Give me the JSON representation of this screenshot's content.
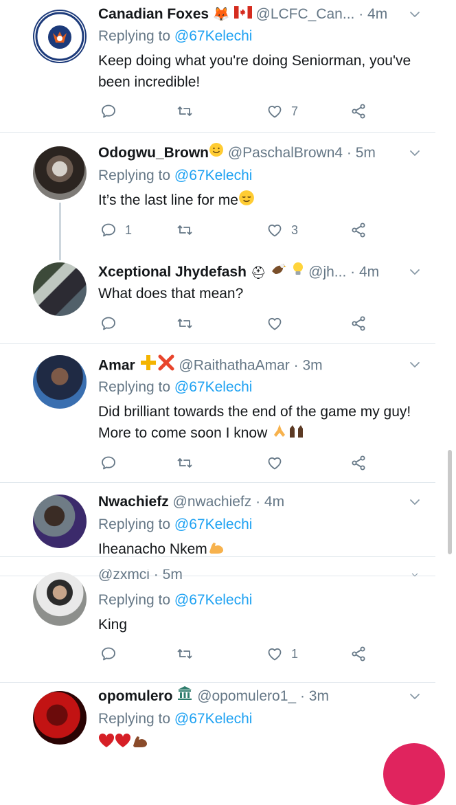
{
  "reply_prefix": "Replying to",
  "tweets": [
    {
      "name": "Canadian Foxes",
      "handle": "@LCFC_Can...",
      "time": "· 4m",
      "reply_to": "@67Kelechi",
      "text": "Keep doing what you're doing Seniorman, you've been incredible!",
      "likes": "7",
      "replies": "",
      "avatar_text": "CANADIAN FOXES"
    },
    {
      "name": "Odogwu_Brown",
      "handle": "@PaschalBrown4",
      "time": "· 5m",
      "reply_to": "@67Kelechi",
      "text": "It’s the last line for me",
      "likes": "3",
      "replies": "1"
    },
    {
      "name": "Xceptional Jhydefash",
      "handle": "@jh...",
      "time": "· 4m",
      "text": "What does that mean?",
      "likes": "",
      "replies": ""
    },
    {
      "name": "Amar",
      "handle": "@RaithathaAmar",
      "time": "· 3m",
      "reply_to": "@67Kelechi",
      "text": "Did brilliant towards the end of the game my guy! More to come soon I know",
      "likes": "",
      "replies": ""
    },
    {
      "name": "Nwachiefz",
      "handle": "@nwachiefz",
      "time": "· 4m",
      "reply_to": "@67Kelechi",
      "text": "Iheanacho Nkem"
    },
    {
      "handle": "@zxmci · 5m",
      "reply_to": "@67Kelechi",
      "text": "King",
      "likes": "1",
      "replies": ""
    },
    {
      "name": "opomulero",
      "handle": "@opomulero1_",
      "time": "· 3m",
      "reply_to": "@67Kelechi",
      "text": ""
    }
  ],
  "icons": [
    "reply-icon",
    "retweet-icon",
    "like-icon",
    "share-icon",
    "chevron-down-icon"
  ],
  "colors": {
    "link": "#1da1f2",
    "muted": "#657786",
    "divider": "#e1e8ed",
    "like_fab": "#e0245e"
  }
}
